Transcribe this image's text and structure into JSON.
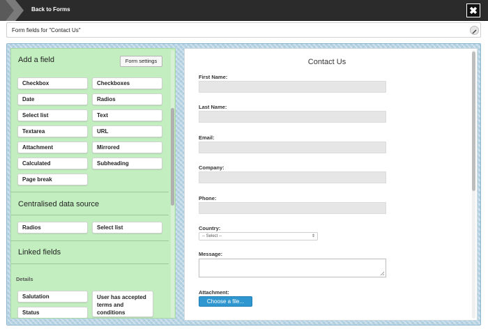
{
  "topbar": {
    "back_label": "Back to Forms",
    "close_label": "✖"
  },
  "subheader": {
    "title": "Form fields for \"Contact Us\""
  },
  "left_panel": {
    "add_field_header": "Add a field",
    "form_settings_label": "Form settings",
    "field_buttons": [
      "Checkbox",
      "Checkboxes",
      "Date",
      "Radios",
      "Select list",
      "Text",
      "Textarea",
      "URL",
      "Attachment",
      "Mirrored",
      "Calculated",
      "Subheading",
      "Page break"
    ],
    "centralised_header": "Centralised data source",
    "centralised_buttons": [
      "Radios",
      "Select list"
    ],
    "linked_header": "Linked fields",
    "details_label": "Details",
    "details_buttons": [
      "Salutation",
      "Status",
      "User has accepted terms and conditions"
    ]
  },
  "form_preview": {
    "title": "Contact Us",
    "labels": {
      "first_name": "First Name:",
      "last_name": "Last Name:",
      "email": "Email:",
      "company": "Company:",
      "phone": "Phone:",
      "country": "Country:",
      "message": "Message:",
      "attachment": "Attachment:"
    },
    "country_select_value": "-- Select --",
    "choose_file_label": "Choose a file..."
  }
}
